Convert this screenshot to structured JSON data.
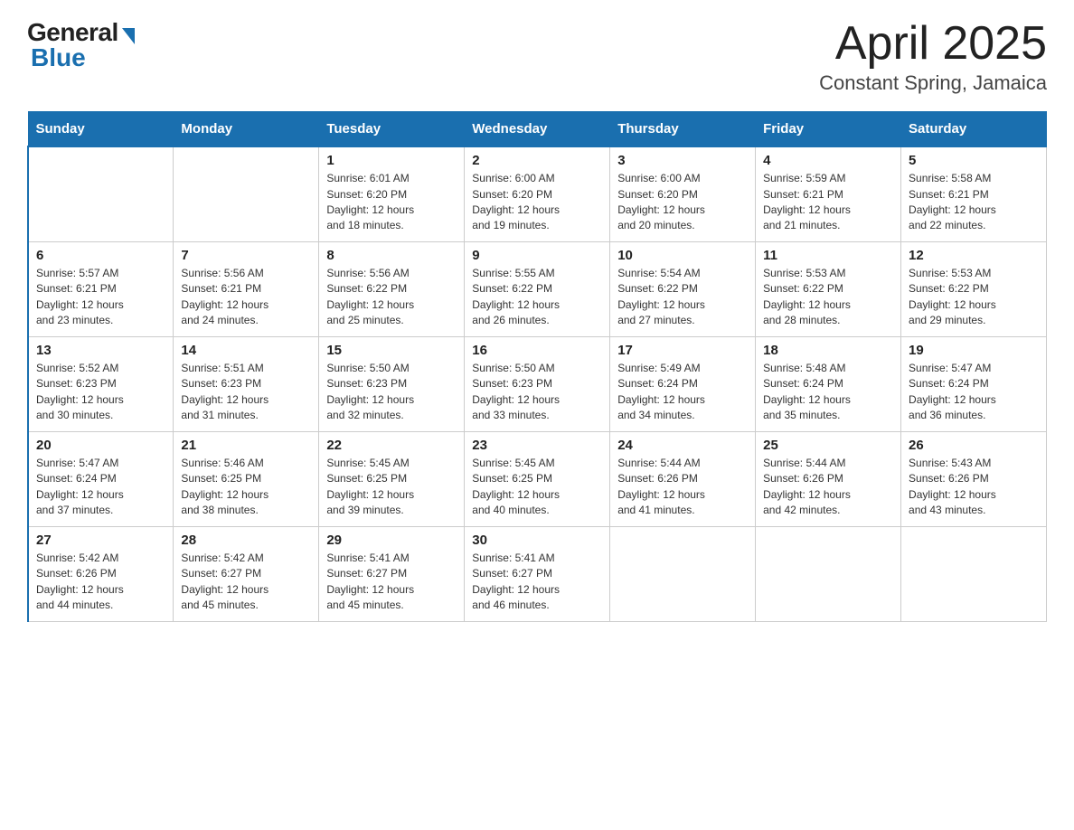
{
  "logo": {
    "general": "General",
    "blue": "Blue"
  },
  "title": "April 2025",
  "location": "Constant Spring, Jamaica",
  "days_of_week": [
    "Sunday",
    "Monday",
    "Tuesday",
    "Wednesday",
    "Thursday",
    "Friday",
    "Saturday"
  ],
  "weeks": [
    [
      {
        "day": "",
        "info": ""
      },
      {
        "day": "",
        "info": ""
      },
      {
        "day": "1",
        "info": "Sunrise: 6:01 AM\nSunset: 6:20 PM\nDaylight: 12 hours\nand 18 minutes."
      },
      {
        "day": "2",
        "info": "Sunrise: 6:00 AM\nSunset: 6:20 PM\nDaylight: 12 hours\nand 19 minutes."
      },
      {
        "day": "3",
        "info": "Sunrise: 6:00 AM\nSunset: 6:20 PM\nDaylight: 12 hours\nand 20 minutes."
      },
      {
        "day": "4",
        "info": "Sunrise: 5:59 AM\nSunset: 6:21 PM\nDaylight: 12 hours\nand 21 minutes."
      },
      {
        "day": "5",
        "info": "Sunrise: 5:58 AM\nSunset: 6:21 PM\nDaylight: 12 hours\nand 22 minutes."
      }
    ],
    [
      {
        "day": "6",
        "info": "Sunrise: 5:57 AM\nSunset: 6:21 PM\nDaylight: 12 hours\nand 23 minutes."
      },
      {
        "day": "7",
        "info": "Sunrise: 5:56 AM\nSunset: 6:21 PM\nDaylight: 12 hours\nand 24 minutes."
      },
      {
        "day": "8",
        "info": "Sunrise: 5:56 AM\nSunset: 6:22 PM\nDaylight: 12 hours\nand 25 minutes."
      },
      {
        "day": "9",
        "info": "Sunrise: 5:55 AM\nSunset: 6:22 PM\nDaylight: 12 hours\nand 26 minutes."
      },
      {
        "day": "10",
        "info": "Sunrise: 5:54 AM\nSunset: 6:22 PM\nDaylight: 12 hours\nand 27 minutes."
      },
      {
        "day": "11",
        "info": "Sunrise: 5:53 AM\nSunset: 6:22 PM\nDaylight: 12 hours\nand 28 minutes."
      },
      {
        "day": "12",
        "info": "Sunrise: 5:53 AM\nSunset: 6:22 PM\nDaylight: 12 hours\nand 29 minutes."
      }
    ],
    [
      {
        "day": "13",
        "info": "Sunrise: 5:52 AM\nSunset: 6:23 PM\nDaylight: 12 hours\nand 30 minutes."
      },
      {
        "day": "14",
        "info": "Sunrise: 5:51 AM\nSunset: 6:23 PM\nDaylight: 12 hours\nand 31 minutes."
      },
      {
        "day": "15",
        "info": "Sunrise: 5:50 AM\nSunset: 6:23 PM\nDaylight: 12 hours\nand 32 minutes."
      },
      {
        "day": "16",
        "info": "Sunrise: 5:50 AM\nSunset: 6:23 PM\nDaylight: 12 hours\nand 33 minutes."
      },
      {
        "day": "17",
        "info": "Sunrise: 5:49 AM\nSunset: 6:24 PM\nDaylight: 12 hours\nand 34 minutes."
      },
      {
        "day": "18",
        "info": "Sunrise: 5:48 AM\nSunset: 6:24 PM\nDaylight: 12 hours\nand 35 minutes."
      },
      {
        "day": "19",
        "info": "Sunrise: 5:47 AM\nSunset: 6:24 PM\nDaylight: 12 hours\nand 36 minutes."
      }
    ],
    [
      {
        "day": "20",
        "info": "Sunrise: 5:47 AM\nSunset: 6:24 PM\nDaylight: 12 hours\nand 37 minutes."
      },
      {
        "day": "21",
        "info": "Sunrise: 5:46 AM\nSunset: 6:25 PM\nDaylight: 12 hours\nand 38 minutes."
      },
      {
        "day": "22",
        "info": "Sunrise: 5:45 AM\nSunset: 6:25 PM\nDaylight: 12 hours\nand 39 minutes."
      },
      {
        "day": "23",
        "info": "Sunrise: 5:45 AM\nSunset: 6:25 PM\nDaylight: 12 hours\nand 40 minutes."
      },
      {
        "day": "24",
        "info": "Sunrise: 5:44 AM\nSunset: 6:26 PM\nDaylight: 12 hours\nand 41 minutes."
      },
      {
        "day": "25",
        "info": "Sunrise: 5:44 AM\nSunset: 6:26 PM\nDaylight: 12 hours\nand 42 minutes."
      },
      {
        "day": "26",
        "info": "Sunrise: 5:43 AM\nSunset: 6:26 PM\nDaylight: 12 hours\nand 43 minutes."
      }
    ],
    [
      {
        "day": "27",
        "info": "Sunrise: 5:42 AM\nSunset: 6:26 PM\nDaylight: 12 hours\nand 44 minutes."
      },
      {
        "day": "28",
        "info": "Sunrise: 5:42 AM\nSunset: 6:27 PM\nDaylight: 12 hours\nand 45 minutes."
      },
      {
        "day": "29",
        "info": "Sunrise: 5:41 AM\nSunset: 6:27 PM\nDaylight: 12 hours\nand 45 minutes."
      },
      {
        "day": "30",
        "info": "Sunrise: 5:41 AM\nSunset: 6:27 PM\nDaylight: 12 hours\nand 46 minutes."
      },
      {
        "day": "",
        "info": ""
      },
      {
        "day": "",
        "info": ""
      },
      {
        "day": "",
        "info": ""
      }
    ]
  ]
}
